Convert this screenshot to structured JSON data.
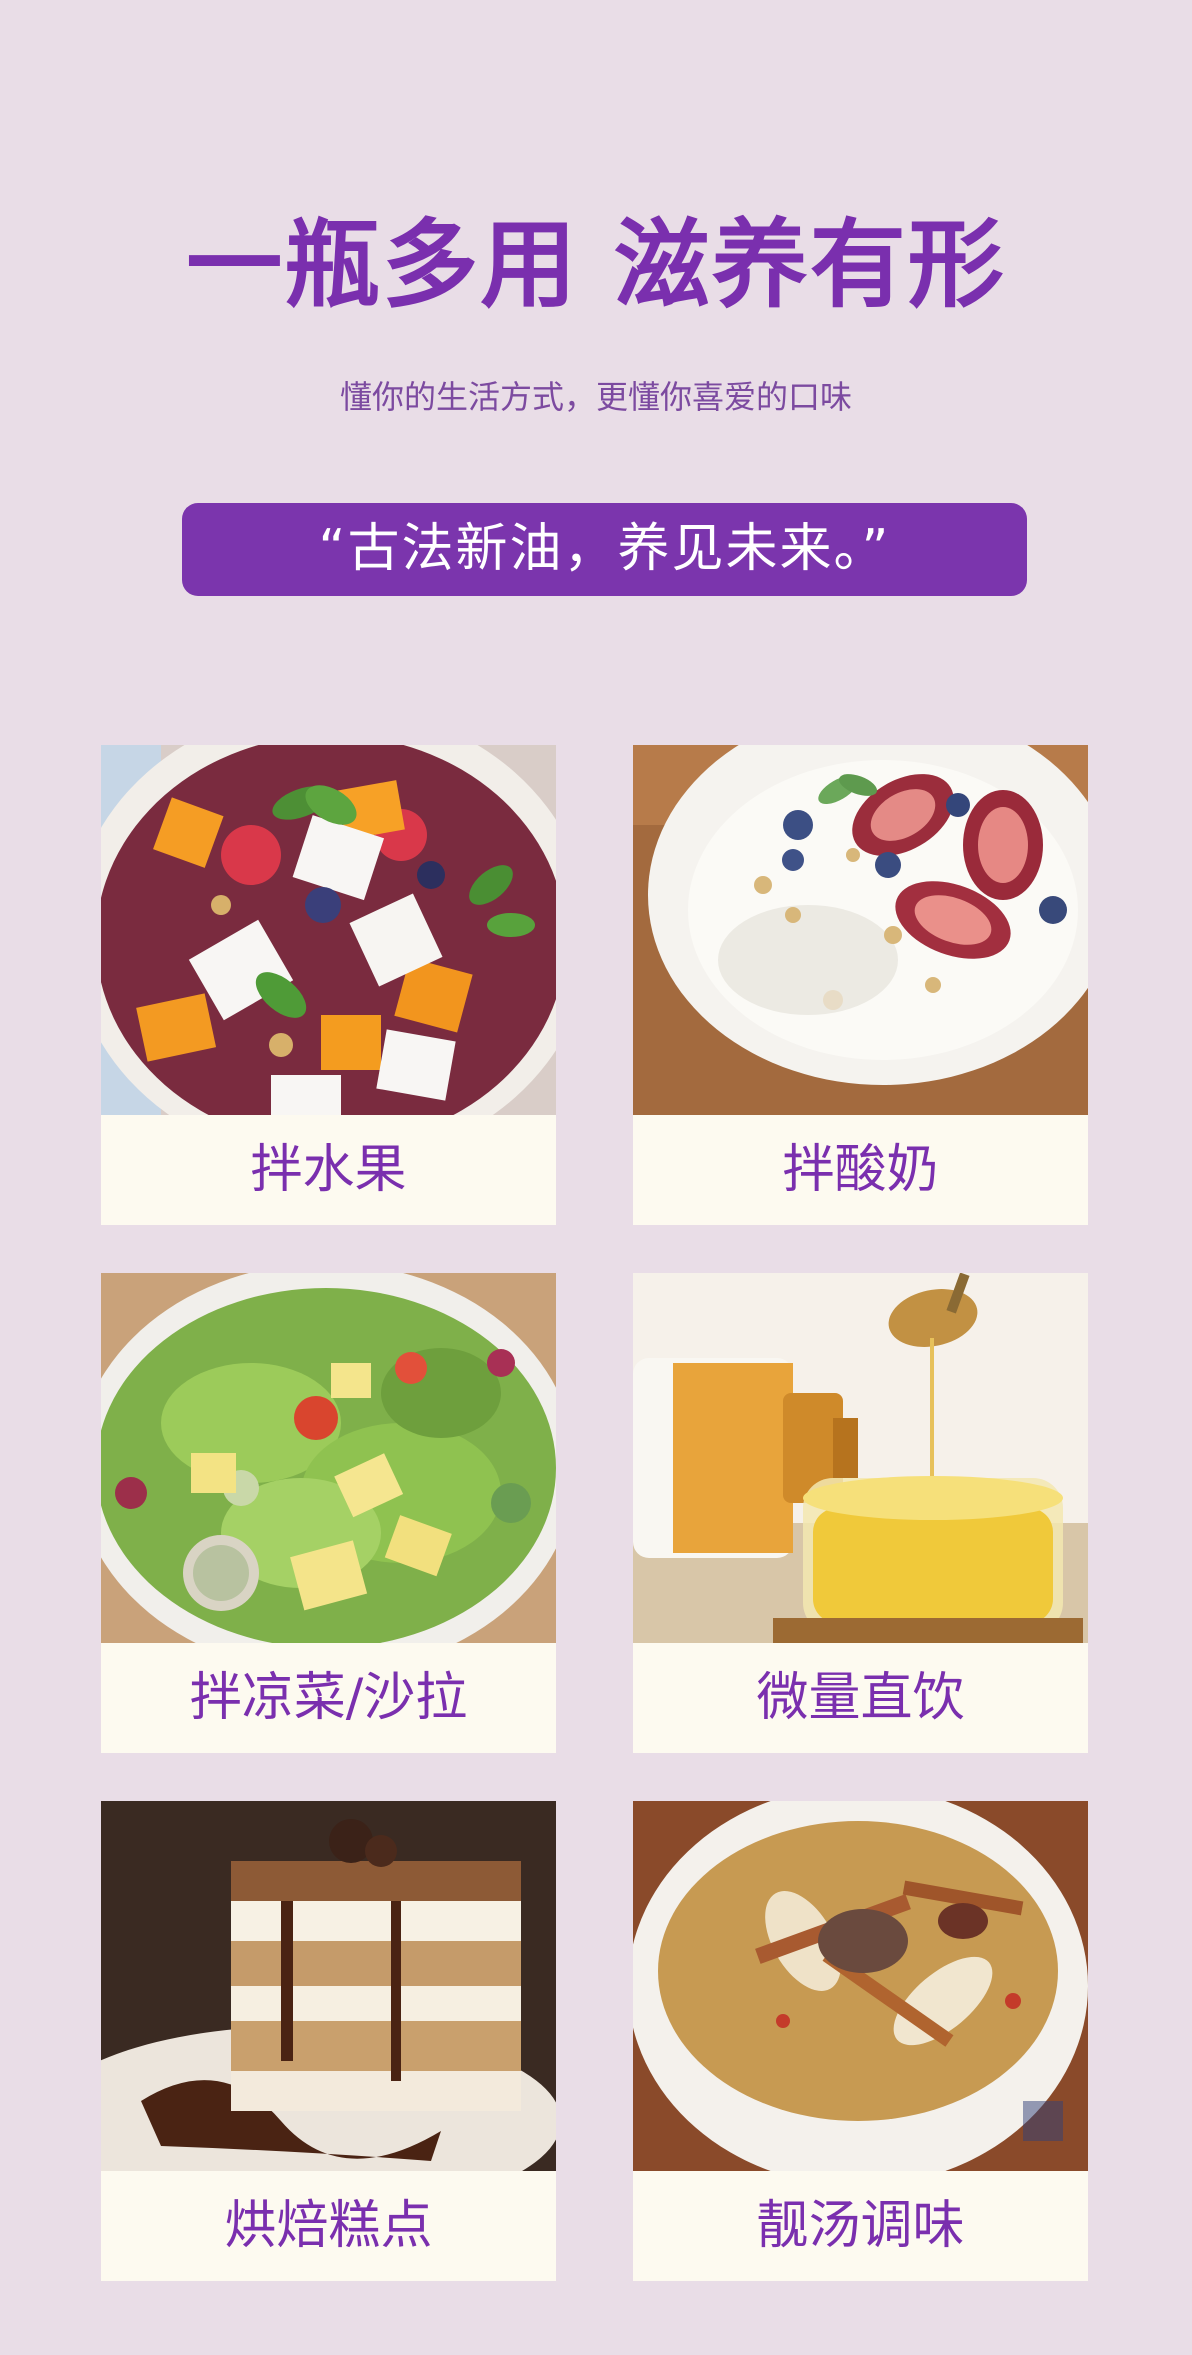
{
  "header": {
    "title": "一瓶多用 滋养有形",
    "subtitle": "懂你的生活方式，更懂你喜爱的口味",
    "slogan": "“古法新油，养见未来。”"
  },
  "uses": [
    {
      "label": "拌水果",
      "icon": "fruit-salad-photo"
    },
    {
      "label": "拌酸奶",
      "icon": "yogurt-bowl-photo"
    },
    {
      "label": "拌凉菜/沙拉",
      "icon": "green-salad-photo"
    },
    {
      "label": "微量直饮",
      "icon": "oil-glass-photo"
    },
    {
      "label": "烘焙糕点",
      "icon": "tiramisu-cake-photo"
    },
    {
      "label": "靓汤调味",
      "icon": "soup-bowl-photo"
    }
  ],
  "colors": {
    "background": "#e9dde7",
    "accent": "#7b35ad",
    "label_bg": "#fdfaf0"
  }
}
